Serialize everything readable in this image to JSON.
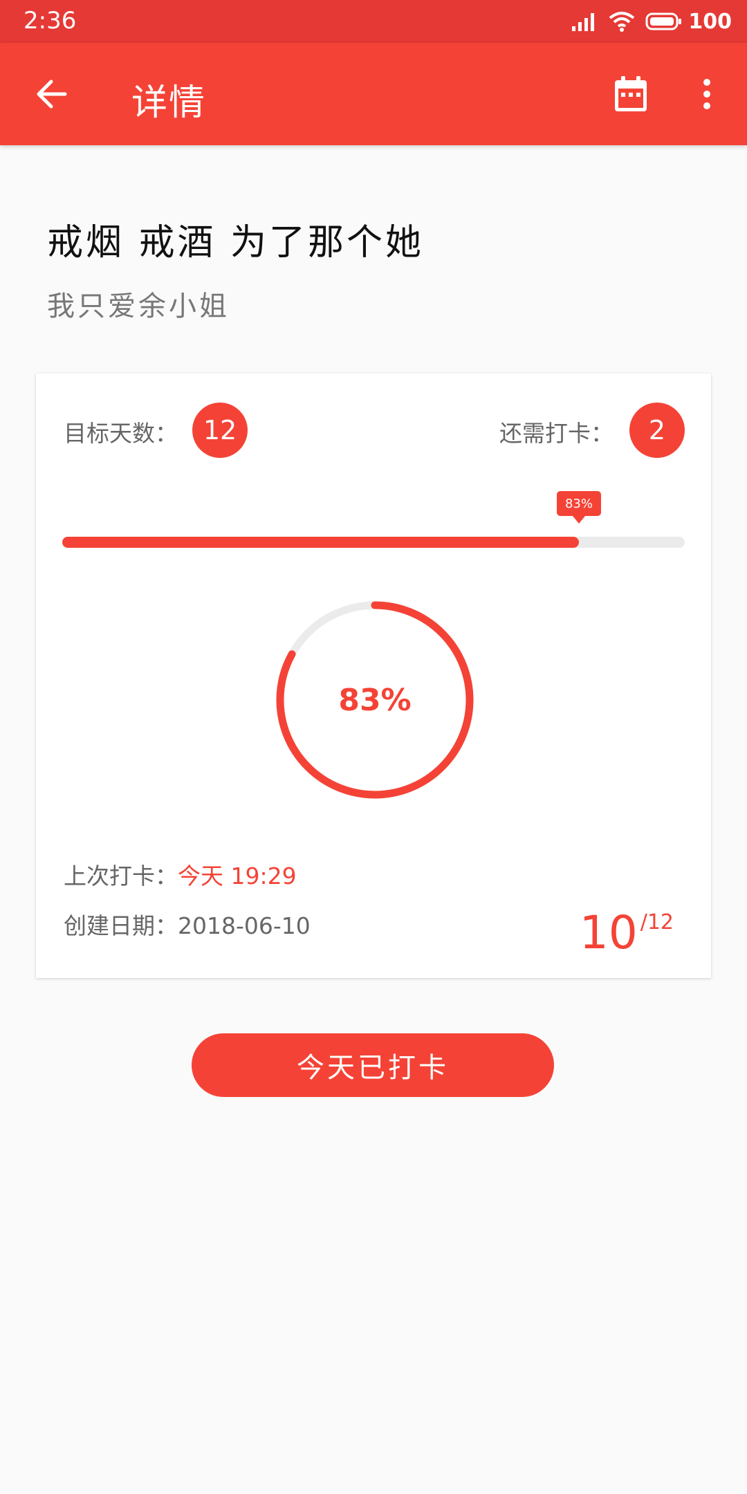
{
  "status_bar": {
    "time": "2:36",
    "battery": "100"
  },
  "app_bar": {
    "title": "详情"
  },
  "habit": {
    "title": "戒烟 戒酒 为了那个她",
    "subtitle": "我只爱余小姐"
  },
  "card": {
    "target_label": "目标天数：",
    "target_days": "12",
    "remaining_label": "还需打卡：",
    "remaining_days": "2",
    "progress_percent": 83,
    "progress_label": "83%",
    "last_checkin_label": "上次打卡：",
    "last_checkin_value": "今天 19:29",
    "created_label": "创建日期：",
    "created_value": "2018-06-10",
    "done_count": "10",
    "total_count": "/12"
  },
  "checkin_button": {
    "label": "今天已打卡"
  },
  "colors": {
    "primary": "#f44336",
    "status_bar": "#e53935",
    "track": "#ebebeb"
  }
}
